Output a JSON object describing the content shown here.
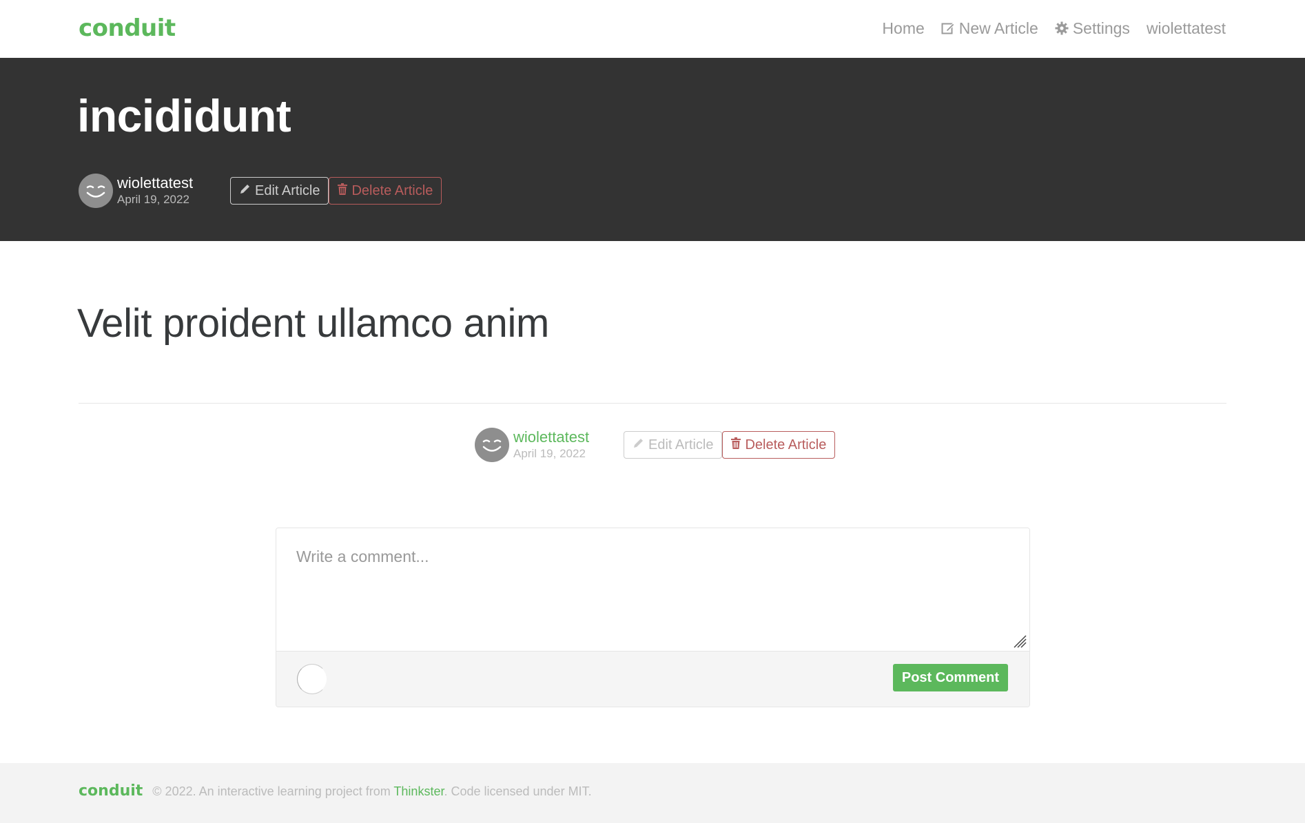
{
  "navbar": {
    "brand": "conduit",
    "links": {
      "home": "Home",
      "new_article": "New Article",
      "settings": "Settings",
      "profile": "wiolettatest"
    }
  },
  "article": {
    "title": "incididunt",
    "body": "Velit proident ullamco anim",
    "author": "wiolettatest",
    "date": "April 19, 2022",
    "edit_label": "Edit Article",
    "delete_label": "Delete Article"
  },
  "comment_form": {
    "placeholder": "Write a comment...",
    "value": "",
    "submit_label": "Post Comment"
  },
  "footer": {
    "brand": "conduit",
    "prefix": "© 2022. An interactive learning project from ",
    "link": "Thinkster",
    "suffix": ". Code licensed under MIT."
  },
  "colors": {
    "accent": "#5cb85c",
    "banner": "#333333",
    "danger": "#b85c5c"
  },
  "icons": {
    "edit": "pencil-icon",
    "delete": "trash-icon",
    "new_article": "compose-icon",
    "settings": "gear-icon",
    "avatar": "smiley-avatar"
  }
}
